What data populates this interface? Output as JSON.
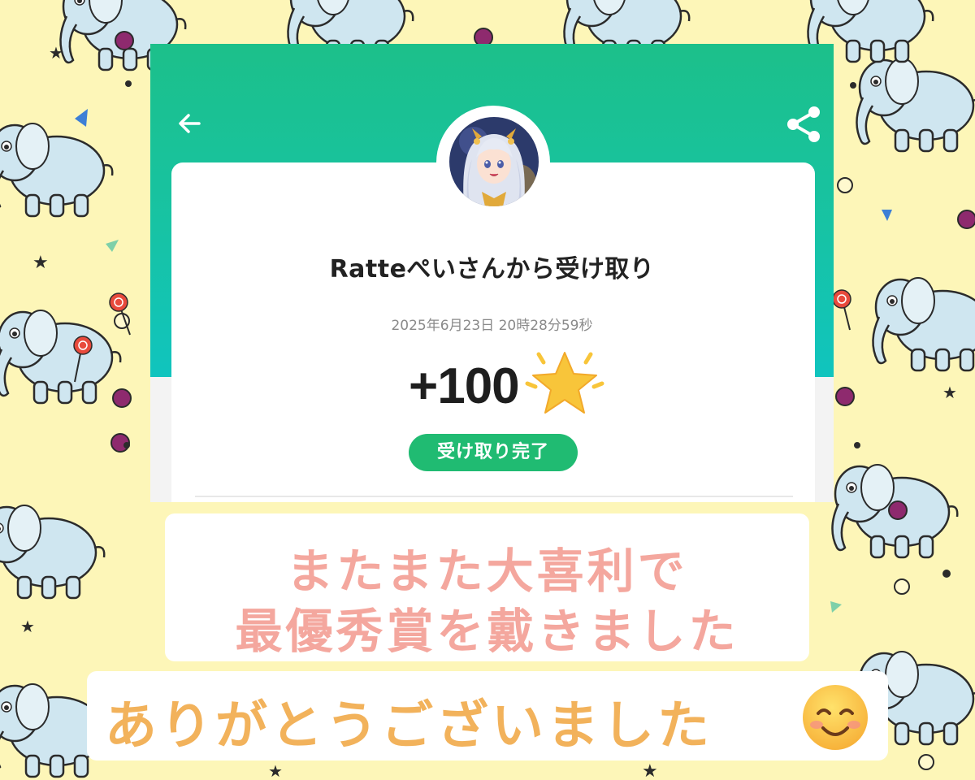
{
  "app": {
    "sender_title": "Ratteぺいさんから受け取り",
    "timestamp": "2025年6月23日 20時28分59秒",
    "amount": "+100",
    "status_label": "受け取り完了",
    "back_icon": "arrow-left-icon",
    "share_icon": "share-icon",
    "amount_icon": "star-icon"
  },
  "caption": {
    "line1": "またまた大喜利で",
    "line2": "最優秀賞を戴きました",
    "thanks": "ありがとうございました",
    "thanks_icon": "smiling-face-emoji"
  },
  "colors": {
    "header_green": "#1cc08a",
    "header_teal": "#10c4be",
    "status_green": "#20bb72",
    "caption_pink": "#f4a79e",
    "thanks_orange": "#f2b25b",
    "background_yellow": "#fdf6b8"
  }
}
